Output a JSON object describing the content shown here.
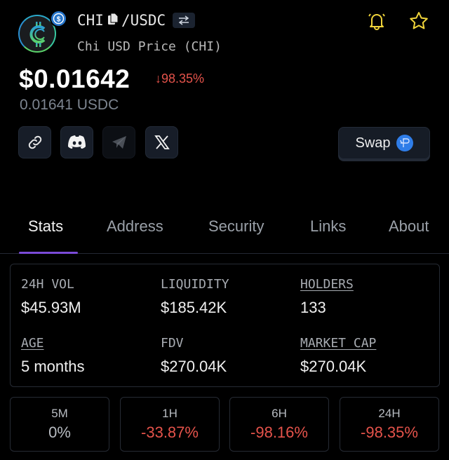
{
  "token": {
    "symbol": "CHI",
    "quote": "/USDC",
    "full_name": "Chi USD Price (CHI)",
    "logo_icon": "chi-logo-icon",
    "quote_badge_icon": "usdc-icon"
  },
  "price": {
    "usd": "$0.01642",
    "change": "98.35%",
    "change_direction": "down",
    "quote_price": "0.01641 USDC"
  },
  "colors": {
    "accent_purple": "#7b4bd8",
    "negative": "#e5534b",
    "alert_yellow": "#f0d43a",
    "usdc_blue": "#2775ca"
  },
  "social": [
    {
      "name": "link",
      "icon": "link-icon"
    },
    {
      "name": "discord",
      "icon": "discord-icon"
    },
    {
      "name": "telegram",
      "icon": "telegram-icon"
    },
    {
      "name": "x",
      "icon": "x-icon"
    }
  ],
  "swap_button": {
    "label": "Swap"
  },
  "tabs": [
    {
      "label": "Stats",
      "active": true
    },
    {
      "label": "Address",
      "active": false
    },
    {
      "label": "Security",
      "active": false
    },
    {
      "label": "Links",
      "active": false
    },
    {
      "label": "About",
      "active": false
    }
  ],
  "stats": [
    {
      "label": "24H VOL",
      "value": "$45.93M",
      "link": false
    },
    {
      "label": "LIQUIDITY",
      "value": "$185.42K",
      "link": false
    },
    {
      "label": "HOLDERS",
      "value": "133",
      "link": true
    },
    {
      "label": "AGE",
      "value": "5 months",
      "link": true
    },
    {
      "label": "FDV",
      "value": "$270.04K",
      "link": false
    },
    {
      "label": "MARKET CAP",
      "value": "$270.04K",
      "link": true
    }
  ],
  "changes": [
    {
      "label": "5M",
      "value": "0%"
    },
    {
      "label": "1H",
      "value": "-33.87%"
    },
    {
      "label": "6H",
      "value": "-98.16%"
    },
    {
      "label": "24H",
      "value": "-98.35%"
    }
  ]
}
